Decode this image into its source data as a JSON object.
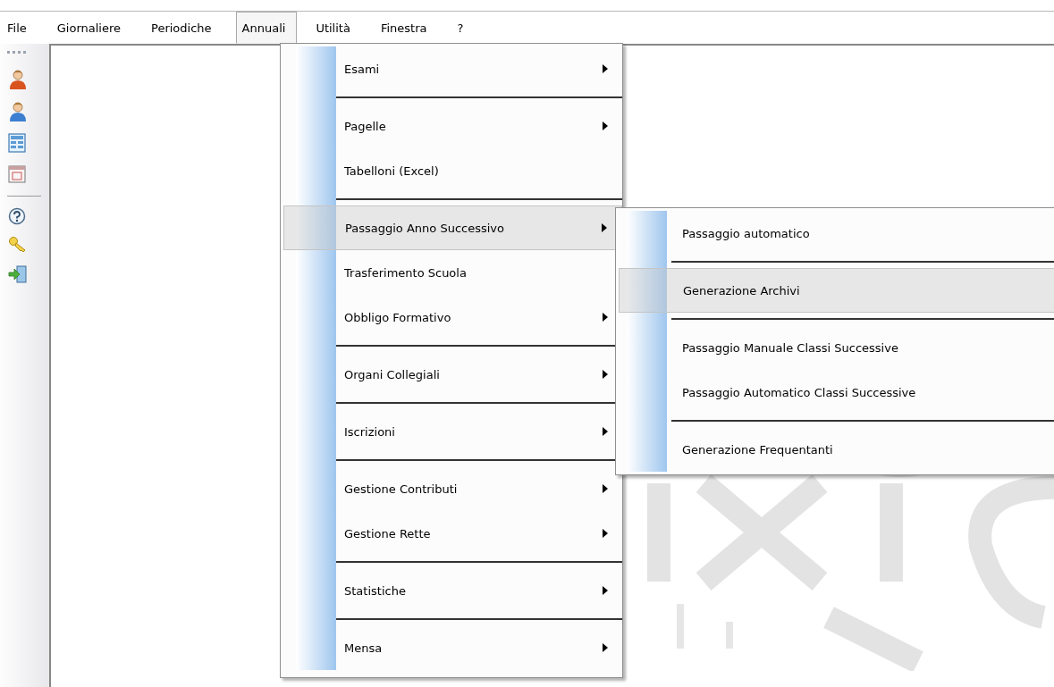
{
  "menubar": [
    {
      "label": "File",
      "selected": false
    },
    {
      "label": "Giornaliere",
      "selected": false
    },
    {
      "label": "Periodiche",
      "selected": false
    },
    {
      "label": "Annuali",
      "selected": true
    },
    {
      "label": "Utilità",
      "selected": false
    },
    {
      "label": "Finestra",
      "selected": false
    },
    {
      "label": "?",
      "selected": false
    }
  ],
  "toolbar": [
    {
      "kind": "person",
      "color": "#d9531e"
    },
    {
      "kind": "person",
      "color": "#3c7fd0"
    },
    {
      "kind": "form"
    },
    {
      "kind": "calendar"
    },
    {
      "kind": "separator"
    },
    {
      "kind": "help"
    },
    {
      "kind": "keys"
    },
    {
      "kind": "exit"
    }
  ],
  "menu": [
    {
      "kind": "item",
      "label": "Esami",
      "submenu": true,
      "selected": false
    },
    {
      "kind": "separator"
    },
    {
      "kind": "item",
      "label": "Pagelle",
      "submenu": true,
      "selected": false
    },
    {
      "kind": "item",
      "label": "Tabelloni (Excel)",
      "submenu": false,
      "selected": false
    },
    {
      "kind": "separator"
    },
    {
      "kind": "item",
      "label": "Passaggio Anno Successivo",
      "submenu": true,
      "selected": true
    },
    {
      "kind": "item",
      "label": "Trasferimento Scuola",
      "submenu": false,
      "selected": false
    },
    {
      "kind": "item",
      "label": "Obbligo Formativo",
      "submenu": true,
      "selected": false
    },
    {
      "kind": "separator"
    },
    {
      "kind": "item",
      "label": "Organi Collegiali",
      "submenu": true,
      "selected": false
    },
    {
      "kind": "separator"
    },
    {
      "kind": "item",
      "label": "Iscrizioni",
      "submenu": true,
      "selected": false
    },
    {
      "kind": "separator"
    },
    {
      "kind": "item",
      "label": "Gestione Contributi",
      "submenu": true,
      "selected": false
    },
    {
      "kind": "item",
      "label": "Gestione Rette",
      "submenu": true,
      "selected": false
    },
    {
      "kind": "separator"
    },
    {
      "kind": "item",
      "label": "Statistiche",
      "submenu": true,
      "selected": false
    },
    {
      "kind": "separator"
    },
    {
      "kind": "item",
      "label": "Mensa",
      "submenu": true,
      "selected": false
    }
  ],
  "submenu": [
    {
      "kind": "item",
      "label": "Passaggio automatico",
      "submenu": false,
      "selected": false
    },
    {
      "kind": "separator"
    },
    {
      "kind": "item",
      "label": "Generazione Archivi",
      "submenu": false,
      "selected": true
    },
    {
      "kind": "separator"
    },
    {
      "kind": "item",
      "label": "Passaggio Manuale Classi Successive",
      "submenu": false,
      "selected": false
    },
    {
      "kind": "item",
      "label": "Passaggio Automatico Classi Successive",
      "submenu": false,
      "selected": false
    },
    {
      "kind": "separator"
    },
    {
      "kind": "item",
      "label": "Generazione Frequentanti",
      "submenu": false,
      "selected": false
    }
  ]
}
